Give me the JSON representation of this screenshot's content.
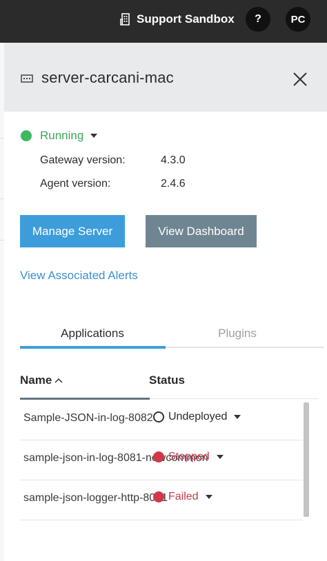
{
  "topbar": {
    "org_name": "Support Sandbox",
    "org_icon": "building-icon",
    "help_label": "?",
    "avatar_initials": "PC"
  },
  "panel": {
    "server_icon": "server-icon",
    "server_name": "server-carcani-mac",
    "close_icon": "close-icon",
    "status": "Running",
    "status_color": "#3fb860",
    "gateway_label": "Gateway version:",
    "gateway_value": "4.3.0",
    "agent_label": "Agent version:",
    "agent_value": "2.4.6",
    "manage_button": "Manage Server",
    "dashboard_button": "View Dashboard",
    "alerts_link": "View Associated Alerts"
  },
  "tabs": [
    {
      "label": "Applications",
      "active": true
    },
    {
      "label": "Plugins",
      "active": false
    }
  ],
  "table": {
    "columns": [
      "Name",
      "Status"
    ],
    "sort_icon": "chevron-up-icon",
    "rows": [
      {
        "name": "Sample-JSON-in-log-8082",
        "status": "Undeployed",
        "status_color": "#ffffff"
      },
      {
        "name": "sample-json-in-log-8081-newcommon",
        "status": "Stopped",
        "status_color": "#d0384a"
      },
      {
        "name": "sample-json-logger-http-8081",
        "status": "Failed",
        "status_color": "#d0384a"
      }
    ]
  },
  "colors": {
    "accent": "#3d9ddb",
    "secondary_button": "#6f8592",
    "running": "#3fb860",
    "error": "#d0384a"
  }
}
